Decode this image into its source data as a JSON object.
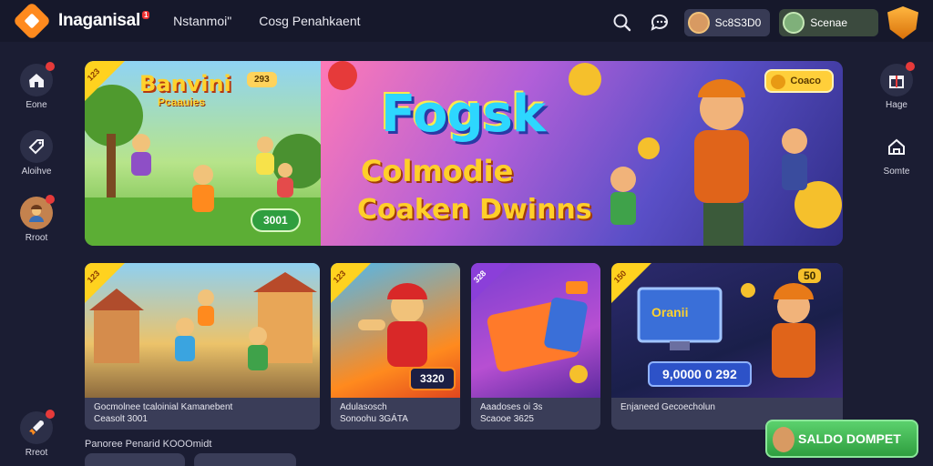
{
  "header": {
    "brand": "Inaganisal",
    "brand_badge": "1",
    "nav": [
      "Nstanmoi\"",
      "Cosg Penahkaent"
    ],
    "balance_1": "Sc8S3D0",
    "balance_2": "Scenae"
  },
  "sidebar_left": [
    {
      "label": "Eone",
      "icon": "home-icon"
    },
    {
      "label": "Aloihve",
      "icon": "tag-icon"
    },
    {
      "label": "Rroot",
      "icon": "avatar-icon"
    }
  ],
  "sidebar_left_bottom": {
    "label": "Rreot",
    "icon": "rocket-icon"
  },
  "sidebar_right": [
    {
      "label": "Hage",
      "icon": "gift-icon"
    },
    {
      "label": "Somte",
      "icon": "house-icon"
    }
  ],
  "hero": {
    "left_ribbon": "123",
    "left_title": "Banvini",
    "left_subtitle": "Pcaauies",
    "left_tag": "293",
    "left_pill": "3001",
    "right_title": "Fogsk",
    "right_line2": "Colmodie",
    "right_line3": "Coaken Dwinns",
    "right_tag": "Coaco"
  },
  "cards": [
    {
      "ribbon": "123",
      "caption_1": "Gocmolnee tcaloinial Kamanebent",
      "caption_2": "Ceasolt 3001"
    },
    {
      "ribbon": "123",
      "counter": "3320",
      "caption_1": "Adulasosch",
      "caption_2": "Sonoohu 3GÁTA"
    },
    {
      "ribbon": "328",
      "caption_1": "Aaadoses oi 3s",
      "caption_2": "Scaooe 3625"
    },
    {
      "ribbon": "150",
      "counter_top": "50",
      "screen": "Oranii",
      "counter": "9,0000 0 292",
      "caption_1": "Enjaneed Gecoecholun"
    }
  ],
  "bottom_label": "Panoree Penarid KOOOmidt",
  "cta": "SALDO DOMPET",
  "colors": {
    "accent": "#ff8a1e",
    "cta": "#3ba94b",
    "ribbon": "#ffd21f",
    "bg": "#1b1d33"
  }
}
